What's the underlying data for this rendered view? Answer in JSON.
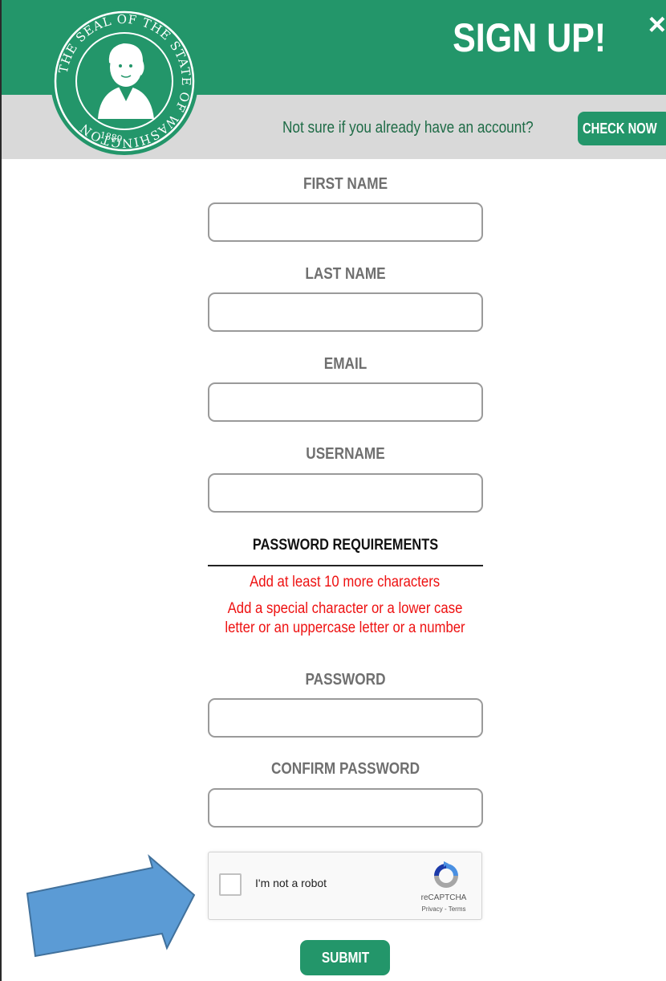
{
  "header": {
    "title": "SIGN UP!",
    "close_label": "×",
    "account_prompt": "Not sure if you already have an account?",
    "check_button": "CHECK NOW",
    "seal": {
      "top_text": "THE SEAL OF THE STATE OF WASHINGTON",
      "year": "1889"
    }
  },
  "form": {
    "first_name_label": "FIRST NAME",
    "last_name_label": "LAST NAME",
    "email_label": "EMAIL",
    "username_label": "USERNAME",
    "password_requirements_heading": "PASSWORD REQUIREMENTS",
    "requirements": [
      "Add at least 10 more characters",
      "Add a special character or a lower case letter or an uppercase letter or a number"
    ],
    "password_label": "PASSWORD",
    "confirm_password_label": "CONFIRM PASSWORD",
    "captcha": {
      "label": "I'm not a robot",
      "brand": "reCAPTCHA",
      "links": "Privacy - Terms"
    },
    "submit_button": "SUBMIT"
  },
  "colors": {
    "brand_green": "#23966a",
    "header_gray": "#d9d9d9",
    "error_red": "#ee1111",
    "arrow_blue": "#5b9bd5"
  }
}
